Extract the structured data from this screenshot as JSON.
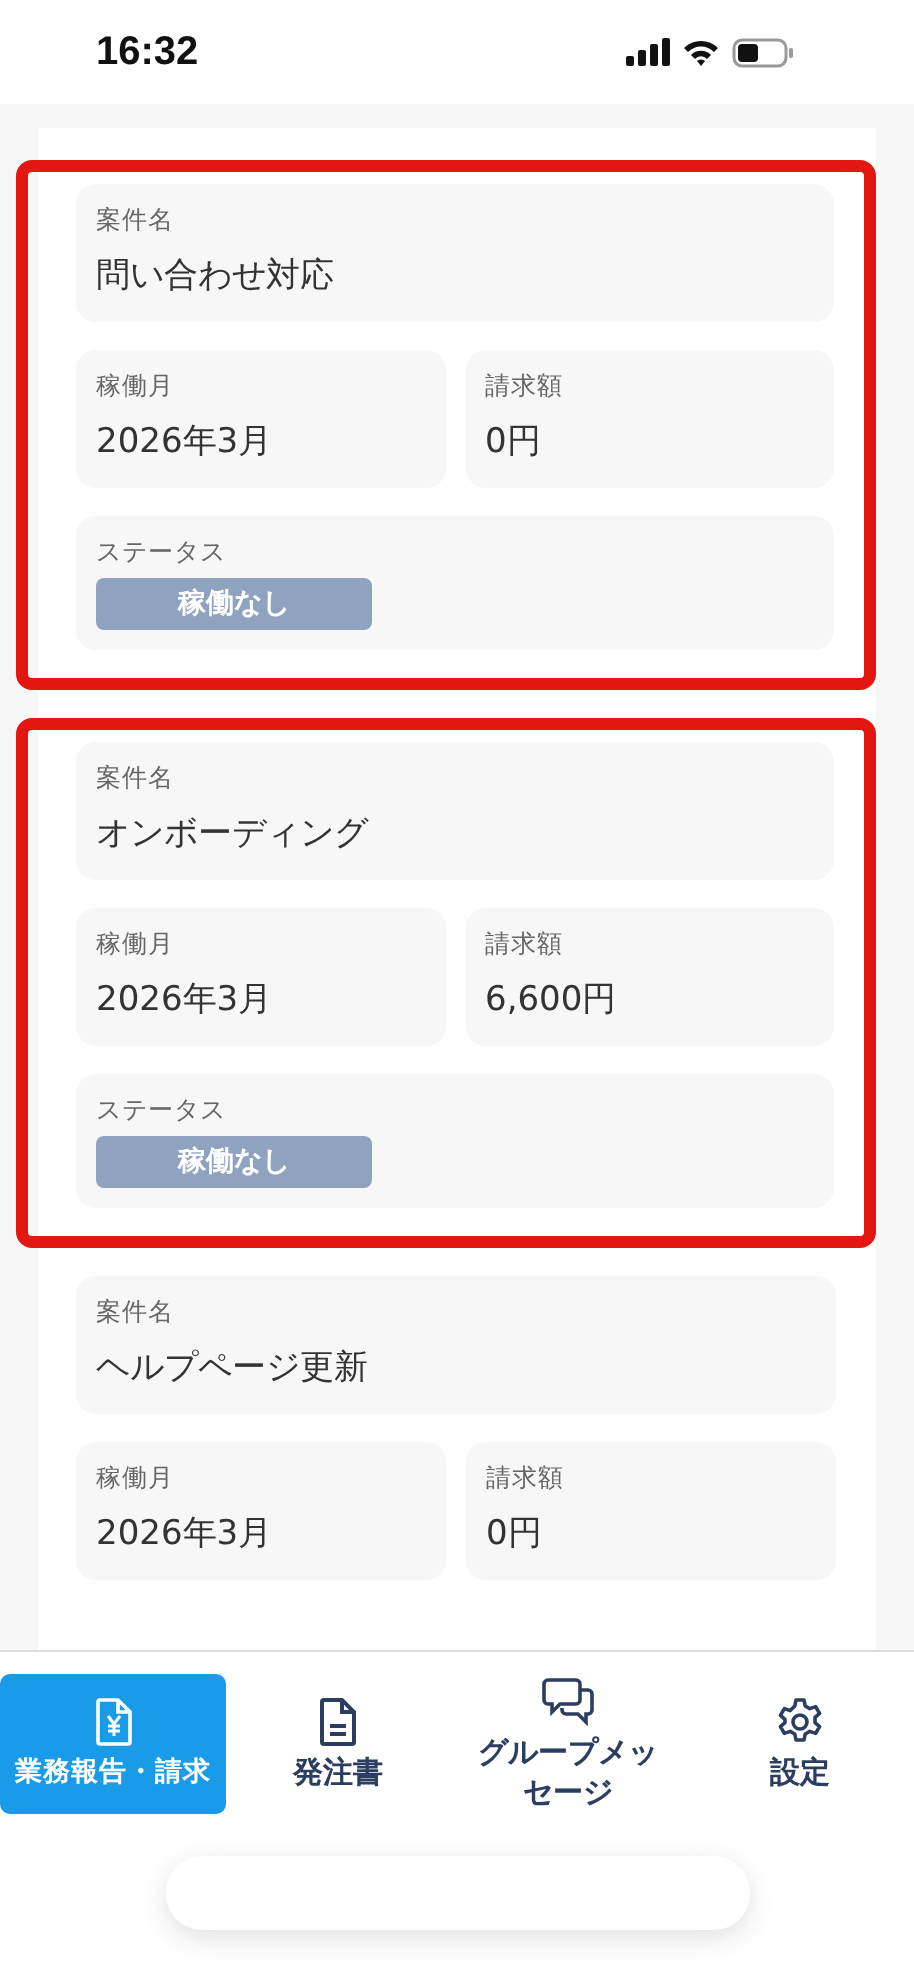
{
  "status_bar": {
    "time": "16:32"
  },
  "cards": [
    {
      "highlighted": true,
      "fields": [
        {
          "kind": "wide",
          "label": "案件名",
          "value": "問い合わせ対応"
        },
        {
          "kind": "half",
          "label": "稼働月",
          "value": "2026年3月"
        },
        {
          "kind": "half",
          "label": "請求額",
          "value": "0円"
        },
        {
          "kind": "status",
          "label": "ステータス",
          "value": "稼働なし"
        }
      ]
    },
    {
      "highlighted": true,
      "fields": [
        {
          "kind": "wide",
          "label": "案件名",
          "value": "オンボーディング"
        },
        {
          "kind": "half",
          "label": "稼働月",
          "value": "2026年3月"
        },
        {
          "kind": "half",
          "label": "請求額",
          "value": "6,600円"
        },
        {
          "kind": "status",
          "label": "ステータス",
          "value": "稼働なし"
        }
      ]
    },
    {
      "highlighted": false,
      "fields": [
        {
          "kind": "wide",
          "label": "案件名",
          "value": "ヘルプページ更新"
        },
        {
          "kind": "half",
          "label": "稼働月",
          "value": "2026年3月"
        },
        {
          "kind": "half",
          "label": "請求額",
          "value": "0円"
        }
      ]
    }
  ],
  "nav": [
    {
      "kind": "invoice",
      "label": "業務報告・請求",
      "selected": true
    },
    {
      "kind": "document",
      "label": "発注書",
      "selected": false
    },
    {
      "kind": "chat",
      "label": "グループメッセージ",
      "selected": false
    },
    {
      "kind": "gear",
      "label": "設定",
      "selected": false
    }
  ]
}
